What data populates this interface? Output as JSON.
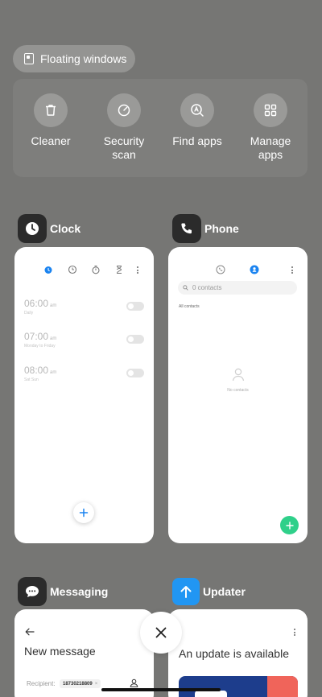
{
  "floating_windows": {
    "label": "Floating windows"
  },
  "tools": [
    {
      "label": "Cleaner",
      "icon": "trash-icon"
    },
    {
      "label": "Security\nscan",
      "icon": "security-scan-icon"
    },
    {
      "label": "Find apps",
      "icon": "find-apps-icon"
    },
    {
      "label": "Manage\napps",
      "icon": "grid-icon"
    }
  ],
  "apps": {
    "clock": {
      "name": "Clock",
      "alarms": [
        {
          "time": "06:00",
          "ampm": "am",
          "label": "Daily"
        },
        {
          "time": "07:00",
          "ampm": "am",
          "label": "Monday to Friday"
        },
        {
          "time": "08:00",
          "ampm": "am",
          "label": "Sat Sun"
        }
      ]
    },
    "phone": {
      "name": "Phone",
      "search_placeholder": "0 contacts",
      "section": "All contacts",
      "empty": "No contacts"
    },
    "messaging": {
      "name": "Messaging",
      "title": "New message",
      "recipient_label": "Recipient:",
      "recipient_value": "18730218809"
    },
    "updater": {
      "name": "Updater",
      "message": "An update is available"
    }
  },
  "colors": {
    "background": "#767674",
    "clock_accent": "#1a83f0",
    "phone_fab": "#2fd08a",
    "updater_icon": "#2196f3"
  }
}
